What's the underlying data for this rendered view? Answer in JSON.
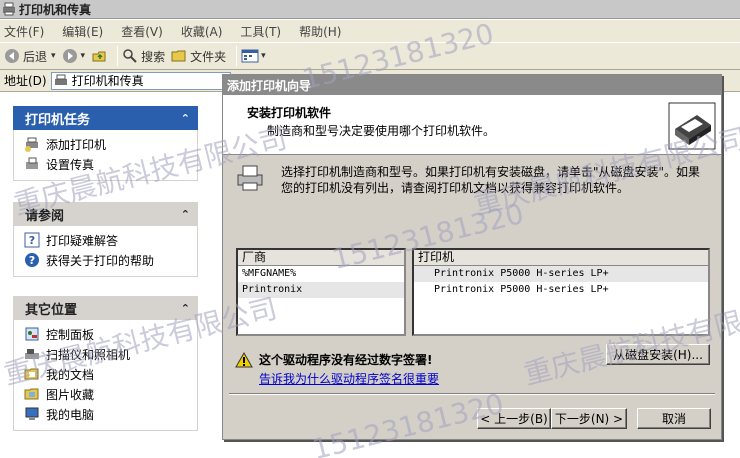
{
  "window": {
    "title": "打印机和传真",
    "menu": [
      "文件(F)",
      "编辑(E)",
      "查看(V)",
      "收藏(A)",
      "工具(T)",
      "帮助(H)"
    ],
    "toolbar": {
      "back": "后退",
      "search": "搜索",
      "folders": "文件夹"
    },
    "address": {
      "label": "地址(D)",
      "value": "打印机和传真"
    }
  },
  "sidebar": {
    "printer_tasks": {
      "title": "打印机任务",
      "items": [
        "添加打印机",
        "设置传真"
      ]
    },
    "see_also": {
      "title": "请参阅",
      "items": [
        "打印疑难解答",
        "获得关于打印的帮助"
      ]
    },
    "other_places": {
      "title": "其它位置",
      "items": [
        "控制面板",
        "扫描仪和照相机",
        "我的文档",
        "图片收藏",
        "我的电脑"
      ]
    }
  },
  "dialog": {
    "title": "添加打印机向导",
    "heading": "安装打印机软件",
    "subheading": "制造商和型号决定要使用哪个打印机软件。",
    "instruction": "选择打印机制造商和型号。如果打印机有安装磁盘，请单击\"从磁盘安装\"。如果您的打印机没有列出，请查阅打印机文档以获得兼容打印机软件。",
    "manufacturer_header": "厂商",
    "manufacturers": [
      "%MFGNAME%",
      "Printronix"
    ],
    "printer_header": "打印机",
    "printers": [
      "Printronix P5000 H-series LP+",
      "Printronix P5000 H-series LP+"
    ],
    "warning": "这个驱动程序没有经过数字签署!",
    "warning_link": "告诉我为什么驱动程序签名很重要",
    "buttons": {
      "have_disk": "从磁盘安装(H)...",
      "back": "< 上一步(B)",
      "next": "下一步(N) >",
      "cancel": "取消"
    }
  },
  "watermark": {
    "text1": "重庆晨航科技有限公司",
    "text2": "15123181320"
  }
}
